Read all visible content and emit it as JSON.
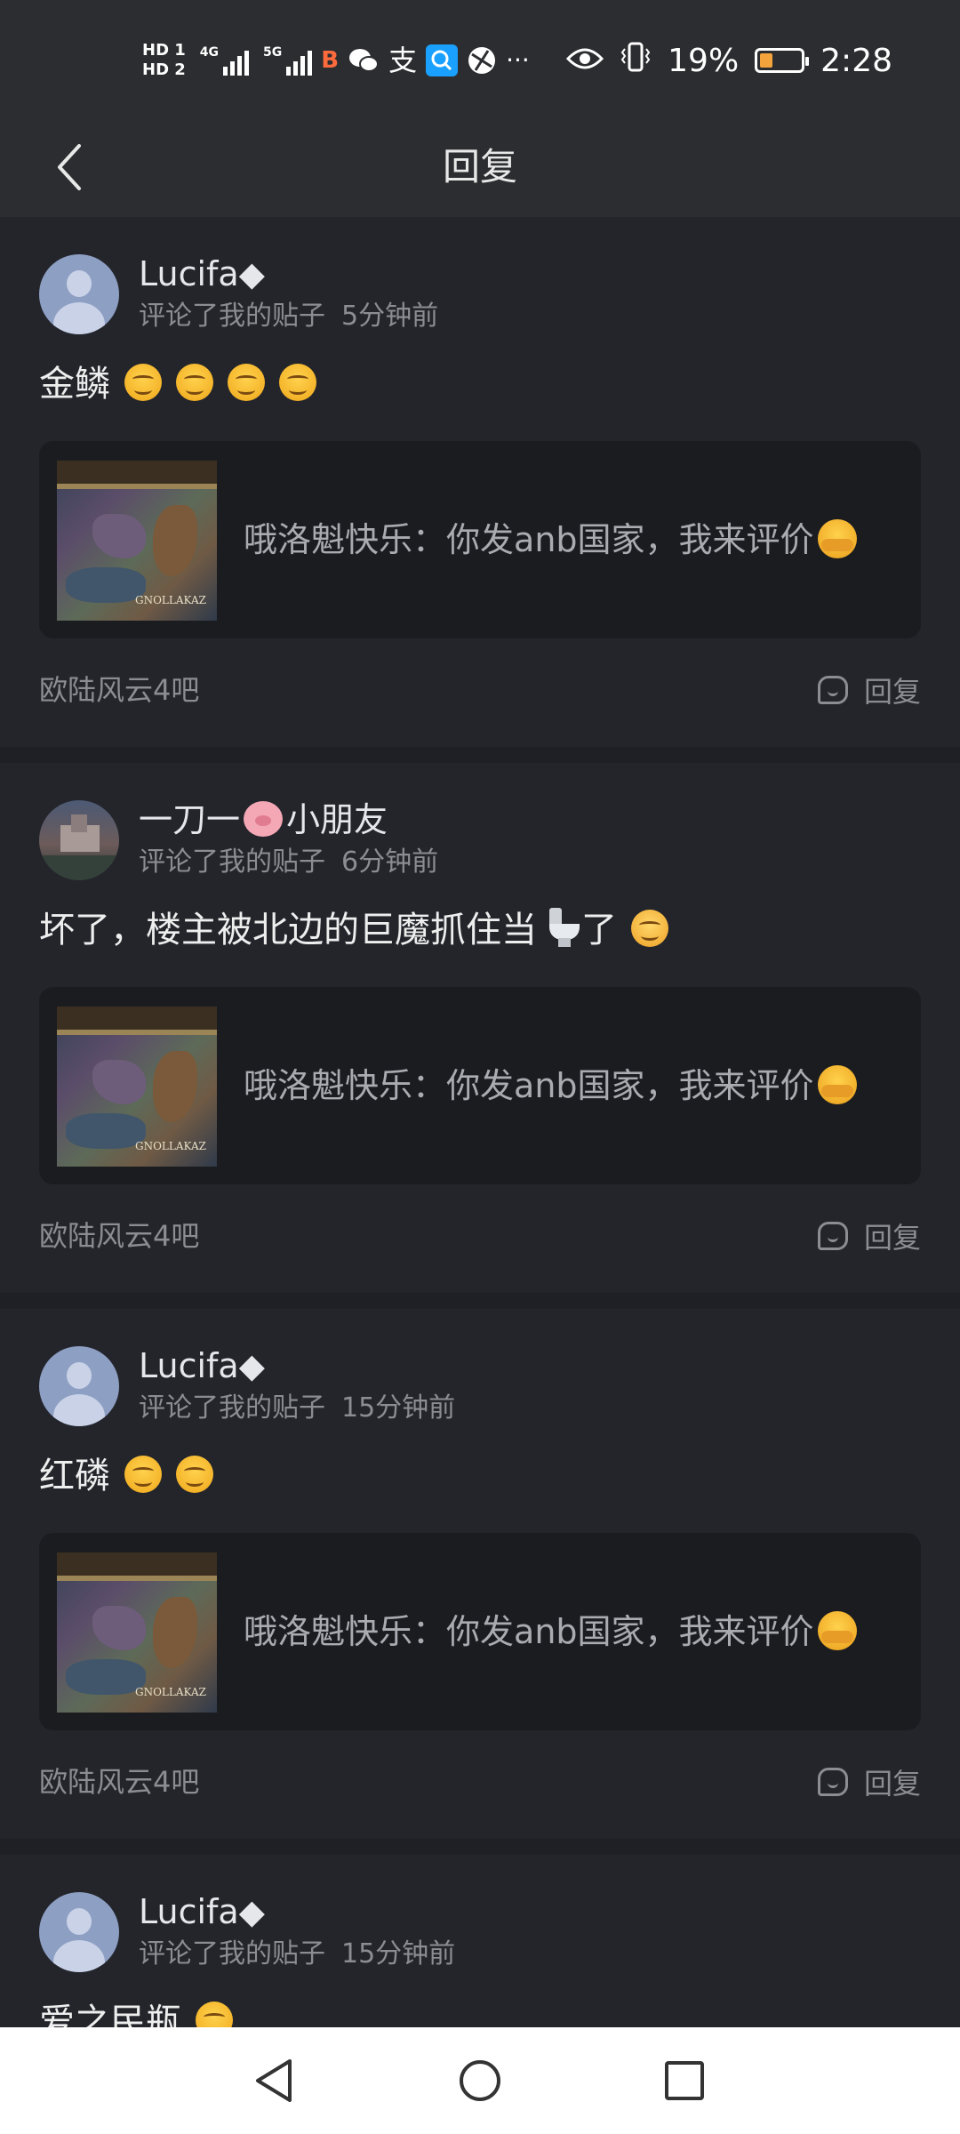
{
  "status_bar": {
    "hd1": "HD 1",
    "hd2": "HD 2",
    "net1": "4G",
    "net2": "5G",
    "battery_pct": "19%",
    "time": "2:28",
    "icons": [
      "baidu-app-icon",
      "wechat-icon",
      "alipay-icon",
      "search-app-icon",
      "browser-icon",
      "more-dots-icon",
      "eye-icon",
      "vibrate-icon",
      "battery-icon"
    ]
  },
  "header": {
    "title": "回复"
  },
  "cards": [
    {
      "username": "Lucifa◆",
      "action": "评论了我的贴子",
      "time": "5分钟前",
      "content": "金鳞",
      "quote_author": "哦洛魁快乐",
      "quote_text": "你发anb国家，我来评价",
      "forum": "欧陆风云4吧",
      "reply_label": "回复"
    },
    {
      "username_a": "一刀一",
      "username_b": "小朋友",
      "action": "评论了我的贴子",
      "time": "6分钟前",
      "content_a": "坏了，楼主被北边的巨魔抓住当",
      "content_b": "了",
      "quote_author": "哦洛魁快乐",
      "quote_text": "你发anb国家，我来评价",
      "forum": "欧陆风云4吧",
      "reply_label": "回复"
    },
    {
      "username": "Lucifa◆",
      "action": "评论了我的贴子",
      "time": "15分钟前",
      "content": "红磷",
      "quote_author": "哦洛魁快乐",
      "quote_text": "你发anb国家，我来评价",
      "forum": "欧陆风云4吧",
      "reply_label": "回复"
    },
    {
      "username": "Lucifa◆",
      "action": "评论了我的贴子",
      "time": "15分钟前",
      "content": "爱之民瓶"
    }
  ],
  "thumbnail_label": "GNOLLAKAZ",
  "colors": {
    "bg": "#1e2026",
    "card": "#23252b",
    "header": "#2c2d30",
    "quote_bg": "#1b1c20",
    "muted": "#8b8d93"
  }
}
